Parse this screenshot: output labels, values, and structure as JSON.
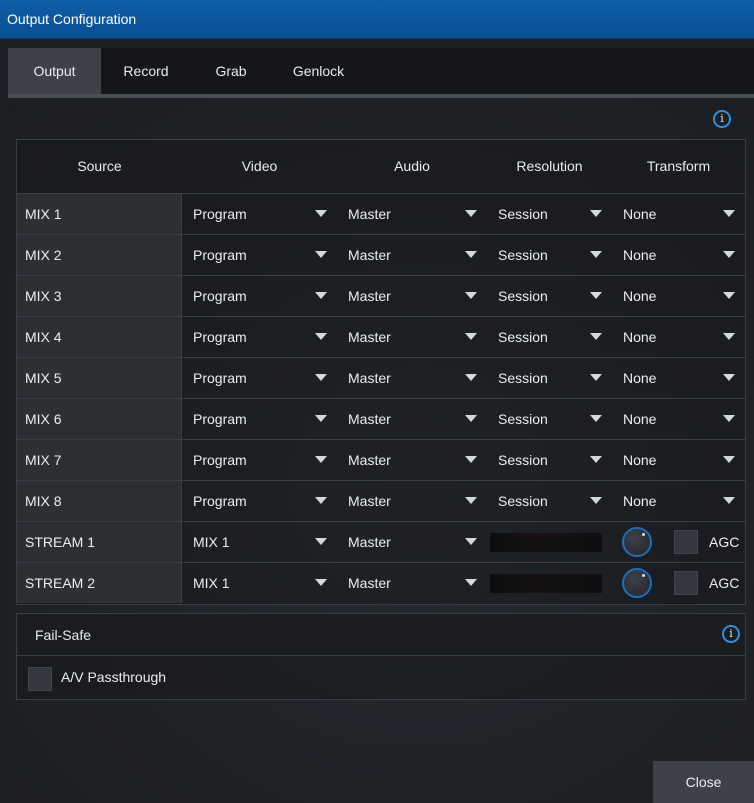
{
  "window": {
    "title": "Output Configuration"
  },
  "tabs": [
    {
      "label": "Output",
      "active": true
    },
    {
      "label": "Record",
      "active": false
    },
    {
      "label": "Grab",
      "active": false
    },
    {
      "label": "Genlock",
      "active": false
    }
  ],
  "icons": {
    "info": "info-icon",
    "dropdown": "caret-down-icon",
    "knob": "gain-knob"
  },
  "info_icon_glyph": "i",
  "table": {
    "headers": {
      "source": "Source",
      "video": "Video",
      "audio": "Audio",
      "resolution": "Resolution",
      "transform": "Transform"
    },
    "mix_rows": [
      {
        "source": "MIX 1",
        "video": "Program",
        "audio": "Master",
        "resolution": "Session",
        "transform": "None"
      },
      {
        "source": "MIX 2",
        "video": "Program",
        "audio": "Master",
        "resolution": "Session",
        "transform": "None"
      },
      {
        "source": "MIX 3",
        "video": "Program",
        "audio": "Master",
        "resolution": "Session",
        "transform": "None"
      },
      {
        "source": "MIX 4",
        "video": "Program",
        "audio": "Master",
        "resolution": "Session",
        "transform": "None"
      },
      {
        "source": "MIX 5",
        "video": "Program",
        "audio": "Master",
        "resolution": "Session",
        "transform": "None"
      },
      {
        "source": "MIX 6",
        "video": "Program",
        "audio": "Master",
        "resolution": "Session",
        "transform": "None"
      },
      {
        "source": "MIX 7",
        "video": "Program",
        "audio": "Master",
        "resolution": "Session",
        "transform": "None"
      },
      {
        "source": "MIX 8",
        "video": "Program",
        "audio": "Master",
        "resolution": "Session",
        "transform": "None"
      }
    ],
    "stream_rows": [
      {
        "source": "STREAM 1",
        "video": "MIX 1",
        "audio": "Master",
        "agc_label": "AGC",
        "agc_checked": false
      },
      {
        "source": "STREAM 2",
        "video": "MIX 1",
        "audio": "Master",
        "agc_label": "AGC",
        "agc_checked": false
      }
    ]
  },
  "failsafe": {
    "title": "Fail-Safe",
    "passthrough_label": "A/V Passthrough",
    "passthrough_checked": false
  },
  "footer": {
    "close_label": "Close"
  },
  "colors": {
    "titlebar": "#0a4f93",
    "accent": "#2f8fe0",
    "active_tab": "#3d4249"
  }
}
